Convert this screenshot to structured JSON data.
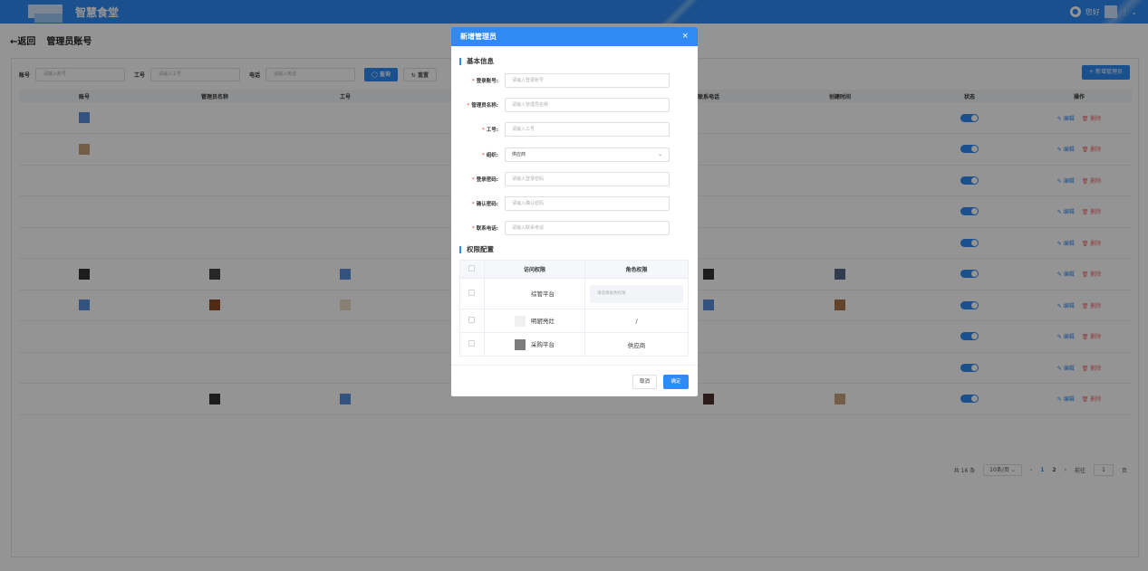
{
  "header": {
    "app_title": "智慧食堂",
    "greeting": "您好",
    "more": "⋮ ⌄"
  },
  "breadcrumb": {
    "back": "←返回",
    "title": "管理员账号"
  },
  "filters": {
    "account_label": "账号",
    "account_placeholder": "请输入账号",
    "jobno_label": "工号",
    "jobno_placeholder": "请输入工号",
    "phone_label": "电话",
    "phone_placeholder": "请输入电话",
    "query": "查询",
    "reset": "重置",
    "add": "+ 新增管理员"
  },
  "table": {
    "columns": [
      "账号",
      "管理员名称",
      "工号",
      "",
      "",
      "",
      "联系电话",
      "创建时间",
      "状态",
      "操作"
    ],
    "edit": "编辑",
    "delete": "删除",
    "row_count": 10
  },
  "pagination": {
    "total": "共 16 条",
    "page_size": "10条/页",
    "pages": [
      "1",
      "2"
    ],
    "goto": "前往",
    "goto_value": "1",
    "page_unit": "页"
  },
  "dialog": {
    "title": "新增管理员",
    "close": "×",
    "basic_section": "基本信息",
    "fields": [
      {
        "label": "登录账号:",
        "placeholder": "请输入登录账号",
        "required": true
      },
      {
        "label": "管理员名称:",
        "placeholder": "请输入管理员名称",
        "required": true
      },
      {
        "label": "工号:",
        "placeholder": "请输入工号",
        "required": true
      },
      {
        "label": "组织:",
        "value": "供应商",
        "required": true
      },
      {
        "label": "登录密码:",
        "placeholder": "请输入登录密码",
        "required": true
      },
      {
        "label": "确认密码:",
        "placeholder": "请输入确认密码",
        "required": true
      },
      {
        "label": "联系电话:",
        "placeholder": "请输入联系电话",
        "required": true
      }
    ],
    "permission_section": "权限配置",
    "perm_columns": [
      "访问权限",
      "角色权限"
    ],
    "perm_rows": [
      {
        "platform": "综管平台",
        "role": "",
        "role_placeholder": "请选择角色权限"
      },
      {
        "platform": "明厨亮灶",
        "role": "/"
      },
      {
        "platform": "采购平台",
        "role": "供应商"
      }
    ],
    "cancel": "取消",
    "confirm": "确定"
  },
  "colors": {
    "accent": "#2f8af4",
    "danger": "#f56c6c"
  }
}
